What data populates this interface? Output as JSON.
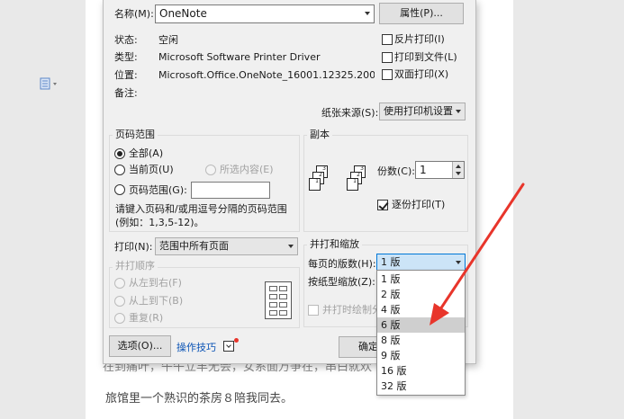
{
  "document": {
    "line1": "在到痛叶，午午立丰无会，女系面万争在，串白就欢",
    "line2": "旅馆里一个熟识的茶房８陪我同去。"
  },
  "printer": {
    "name_label": "名称(M):",
    "name_value": "OneNote",
    "properties_button": "属性(P)...",
    "status_label": "状态:",
    "status_value": "空闲",
    "type_label": "类型:",
    "type_value": "Microsoft Software Printer Driver",
    "location_label": "位置:",
    "location_value": "Microsoft.Office.OneNote_16001.12325.20040",
    "comment_label": "备注:",
    "reverse_print": "反片打印(I)",
    "print_to_file": "打印到文件(L)",
    "duplex": "双面打印(X)",
    "paper_source_label": "纸张来源(S):",
    "paper_source_value": "使用打印机设置"
  },
  "page_range": {
    "title": "页码范围",
    "all": "全部(A)",
    "current": "当前页(U)",
    "selection": "所选内容(E)",
    "pages": "页码范围(G):",
    "hint1": "请键入页码和/或用逗号分隔的页码范围",
    "hint2": "(例如：1,3,5-12)。"
  },
  "print_what": {
    "label": "打印(N):",
    "value": "范围中所有页面"
  },
  "collate_order": {
    "title": "并打顺序",
    "left_right": "从左到右(F)",
    "top_bottom": "从上到下(B)",
    "repeat": "重复(R)"
  },
  "copies": {
    "title": "副本",
    "count_label": "份数(C):",
    "count_value": "1",
    "collate": "逐份打印(T)"
  },
  "zoom": {
    "title": "并打和缩放",
    "pages_per_sheet_label": "每页的版数(H):",
    "pages_per_sheet_value": "1 版",
    "scale_label": "按纸型缩放(Z):",
    "print_border": "并打时绘制分",
    "options": [
      "1 版",
      "2 版",
      "4 版",
      "6 版",
      "8 版",
      "9 版",
      "16 版",
      "32 版"
    ],
    "highlighted_option": "6 版"
  },
  "footer": {
    "options_button": "选项(O)...",
    "tips_link": "操作技巧",
    "ok_button": "确定"
  },
  "colors": {
    "arrow": "#e8352b",
    "dropdown_active": "#cce4f7",
    "dropdown_active_border": "#0078d7",
    "link": "#0a53b5"
  }
}
